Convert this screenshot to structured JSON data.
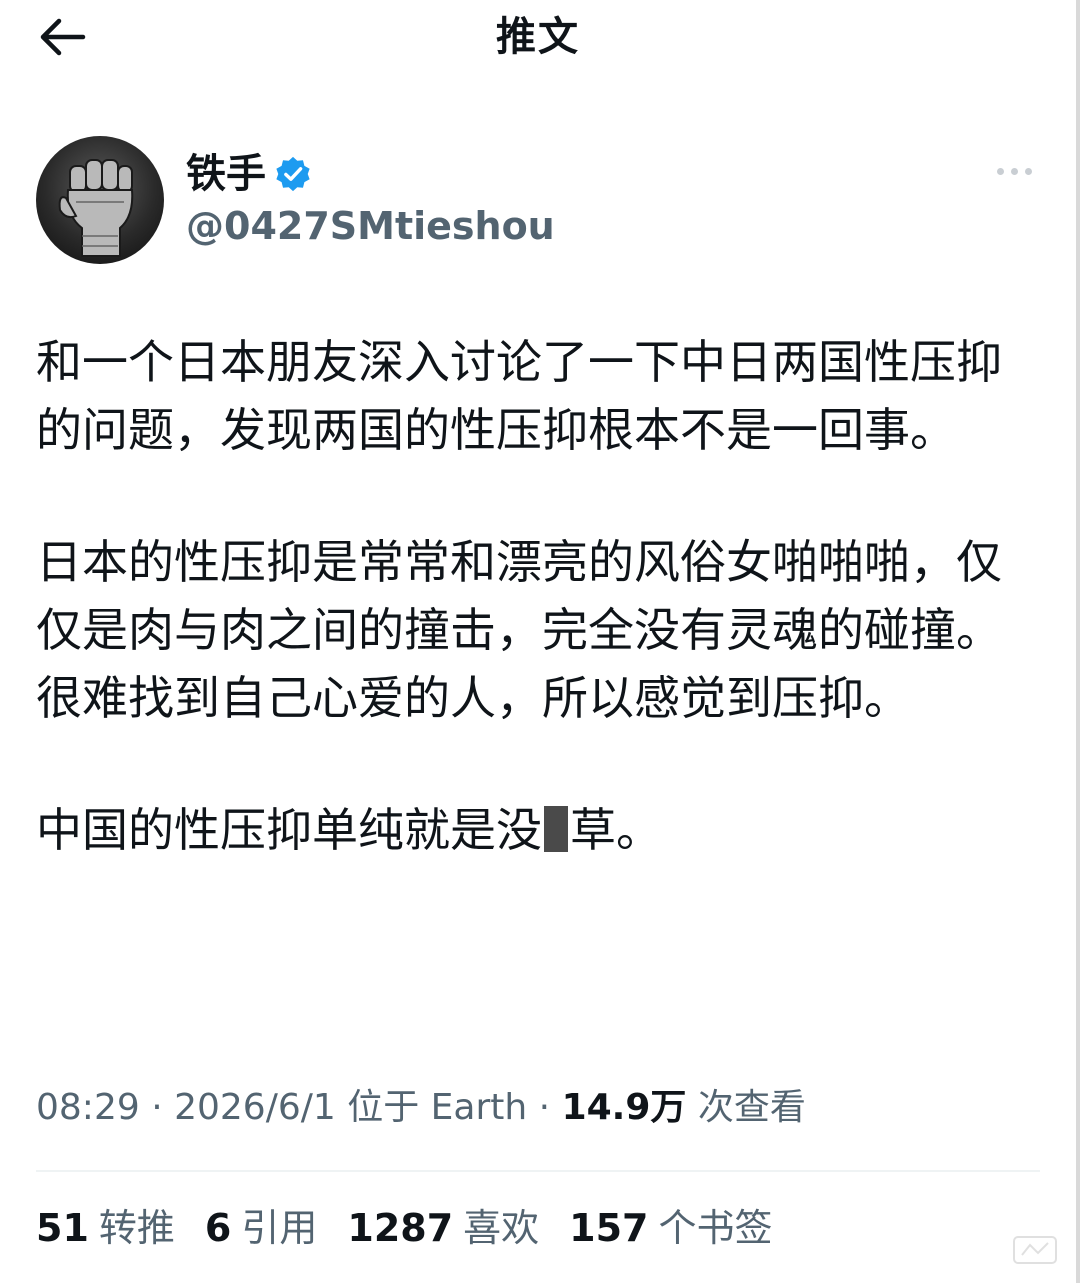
{
  "header": {
    "title": "推文",
    "back_icon": "arrow-left-icon"
  },
  "author": {
    "display_name": "铁手",
    "handle": "@0427SMtieshou",
    "verified": true,
    "verified_color": "#1d9bf0",
    "avatar_icon": "fist-avatar"
  },
  "tweet": {
    "paragraph1": "和一个日本朋友深入讨论了一下中日两国性压抑的问题，发现两国的性压抑根本不是一回事。",
    "paragraph2": "日本的性压抑是常常和漂亮的风俗女啪啪啪，仅仅是肉与肉之间的撞击，完全没有灵魂的碰撞。很难找到自己心爱的人，所以感觉到压抑。",
    "paragraph3_before": "中国的性压抑单纯就是没",
    "paragraph3_after": "草。"
  },
  "meta": {
    "time": "08:29",
    "sep1": " · ",
    "date": "2026/6/1",
    "location_prefix": " 位于 ",
    "location": "Earth",
    "sep2": " · ",
    "views_count": "14.9万",
    "views_label": " 次查看"
  },
  "stats": {
    "retweets_count": "51",
    "retweets_label": "转推",
    "quotes_count": "6",
    "quotes_label": "引用",
    "likes_count": "1287",
    "likes_label": "喜欢",
    "bookmarks_count": "157",
    "bookmarks_label": "个书签"
  },
  "colors": {
    "text_primary": "#0f1419",
    "text_secondary": "#536471",
    "divider": "#eff3f4"
  }
}
